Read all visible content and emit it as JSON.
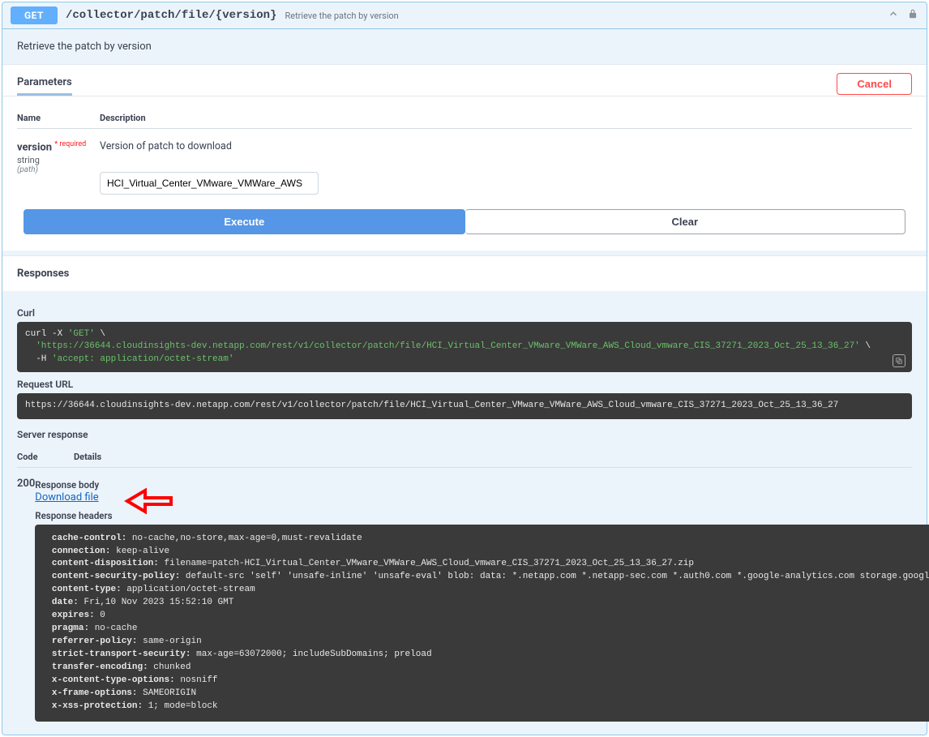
{
  "summary": {
    "method": "GET",
    "path": "/collector/patch/file/{version}",
    "desc": "Retrieve the patch by version"
  },
  "description": "Retrieve the patch by version",
  "tabs": {
    "parameters": "Parameters",
    "cancel": "Cancel"
  },
  "param_head": {
    "name": "Name",
    "desc": "Description"
  },
  "param": {
    "name": "version",
    "required": "* required",
    "type": "string",
    "source": "(path)",
    "desc": "Version of patch to download",
    "value": "HCI_Virtual_Center_VMware_VMWare_AWS"
  },
  "buttons": {
    "execute": "Execute",
    "clear": "Clear"
  },
  "responses_label": "Responses",
  "curl_label": "Curl",
  "curl": {
    "l1a": "curl -X ",
    "l1b": "'GET'",
    "l1c": " \\",
    "l2": "  'https://36644.cloudinsights-dev.netapp.com/rest/v1/collector/patch/file/HCI_Virtual_Center_VMware_VMWare_AWS_Cloud_vmware_CIS_37271_2023_Oct_25_13_36_27'",
    "l2b": " \\",
    "l3a": "  -H ",
    "l3b": "'accept: application/octet-stream'"
  },
  "request_url_label": "Request URL",
  "request_url": "https://36644.cloudinsights-dev.netapp.com/rest/v1/collector/patch/file/HCI_Virtual_Center_VMware_VMWare_AWS_Cloud_vmware_CIS_37271_2023_Oct_25_13_36_27",
  "server_response_label": "Server response",
  "resp_head": {
    "code": "Code",
    "details": "Details"
  },
  "response": {
    "code": "200",
    "body_label": "Response body",
    "download": "Download file",
    "headers_label": "Response headers",
    "headers": [
      " cache-control: no-cache,no-store,max-age=0,must-revalidate",
      " connection: keep-alive",
      " content-disposition: filename=patch-HCI_Virtual_Center_VMware_VMWare_AWS_Cloud_vmware_CIS_37271_2023_Oct_25_13_36_27.zip",
      " content-security-policy: default-src 'self' 'unsafe-inline' 'unsafe-eval' blob: data: *.netapp.com *.netapp-sec.com *.auth0.com *.google-analytics.com storage.googleapis.com *.spotinst.com",
      " content-type: application/octet-stream",
      " date: Fri,10 Nov 2023 15:52:10 GMT",
      " expires: 0",
      " pragma: no-cache",
      " referrer-policy: same-origin",
      " strict-transport-security: max-age=63072000; includeSubDomains; preload",
      " transfer-encoding: chunked",
      " x-content-type-options: nosniff",
      " x-frame-options: SAMEORIGIN",
      " x-xss-protection: 1; mode=block"
    ]
  }
}
